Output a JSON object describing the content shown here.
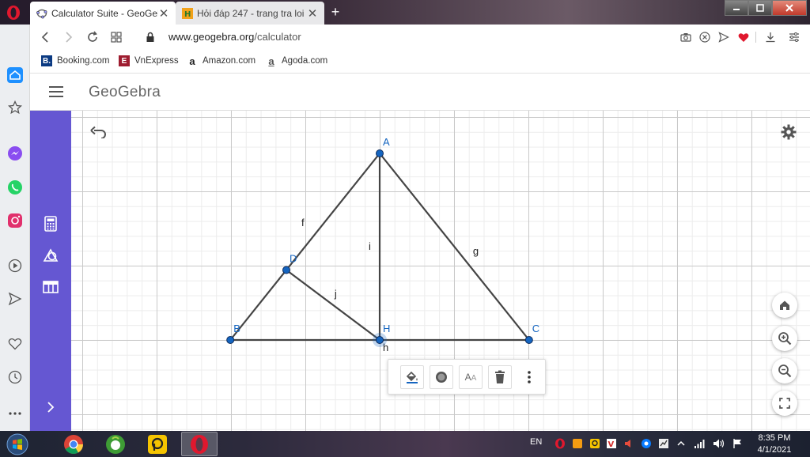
{
  "browser": {
    "tabs": [
      {
        "title": "Calculator Suite - GeoGebr",
        "active": true,
        "close": "✕"
      },
      {
        "title": "Hỏi đáp 247 - trang tra loi",
        "active": false,
        "close": "✕"
      }
    ],
    "new_tab": "+",
    "url_domain": "www.geogebra.org",
    "url_path": "/calculator",
    "bookmarks": [
      {
        "label": "Booking.com",
        "icon": "B.",
        "color": "#0b3a82"
      },
      {
        "label": "VnExpress",
        "icon": "E",
        "color": "#9e1c2f"
      },
      {
        "label": "Amazon.com",
        "icon": "a",
        "color": "#222222"
      },
      {
        "label": "Agoda.com",
        "icon": "a",
        "color": "#555555"
      }
    ]
  },
  "app": {
    "brand": "GeoGebra",
    "accent": "#6557d2"
  },
  "geometry": {
    "points": [
      {
        "name": "A",
        "x": 0,
        "y": 4
      },
      {
        "name": "B",
        "x": -3.2,
        "y": 0
      },
      {
        "name": "C",
        "x": 3.2,
        "y": 0
      },
      {
        "name": "H",
        "x": 0,
        "y": 0
      },
      {
        "name": "D",
        "x": -2,
        "y": 1.5
      }
    ],
    "segments": [
      {
        "name": "f",
        "from": "B",
        "to": "A"
      },
      {
        "name": "g",
        "from": "A",
        "to": "C"
      },
      {
        "name": "h",
        "from": "B",
        "to": "C"
      },
      {
        "name": "i",
        "from": "A",
        "to": "H"
      },
      {
        "name": "j",
        "from": "D",
        "to": "H"
      }
    ],
    "selected_point": "H",
    "point_color": "#1565c0",
    "line_color": "#444444"
  },
  "stylebar": {
    "text_style_label": "A",
    "text_style_small": "A"
  },
  "taskbar": {
    "language": "EN",
    "time": "8:35 PM",
    "date": "4/1/2021"
  }
}
